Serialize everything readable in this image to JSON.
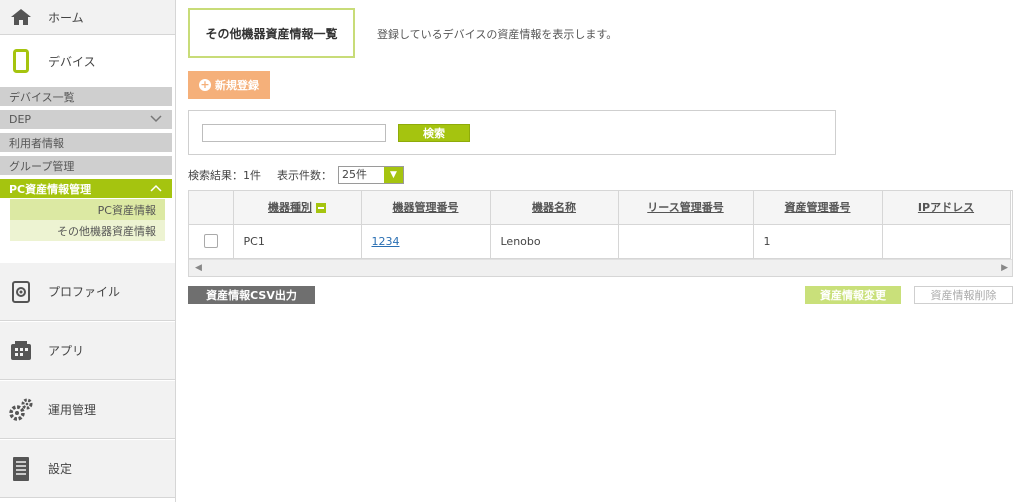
{
  "sidebar": {
    "home": "ホーム",
    "device": "デバイス",
    "device_sub": [
      {
        "label": "デバイス一覧"
      },
      {
        "label": "DEP"
      },
      {
        "label": "利用者情報"
      },
      {
        "label": "グループ管理"
      },
      {
        "label": "PC資産情報管理"
      }
    ],
    "asset_sub": [
      "PC資産情報",
      "その他機器資産情報"
    ],
    "profile": "プロファイル",
    "app": "アプリ",
    "ops": "運用管理",
    "settings": "設定"
  },
  "page": {
    "title": "その他機器資産情報一覧",
    "description": "登録しているデバイスの資産情報を表示します。",
    "new_button": "新規登録"
  },
  "search": {
    "value": "",
    "button": "検索"
  },
  "results": {
    "summary": "検索結果：1件",
    "per_page_label": "表示件数：",
    "per_page_value": "25件"
  },
  "table": {
    "headers": [
      "機器種別",
      "機器管理番号",
      "機器名称",
      "リース管理番号",
      "資産管理番号",
      "IPアドレス"
    ],
    "rows": [
      {
        "type": "PC1",
        "mgmt_no": "1234",
        "name": "Lenobo",
        "lease_no": "",
        "asset_no": "1",
        "ip": ""
      }
    ]
  },
  "actions": {
    "csv": "資産情報CSV出力",
    "edit": "資産情報変更",
    "delete": "資産情報削除"
  },
  "colors": {
    "accent": "#a5c40f",
    "orange": "#f5b07a"
  }
}
